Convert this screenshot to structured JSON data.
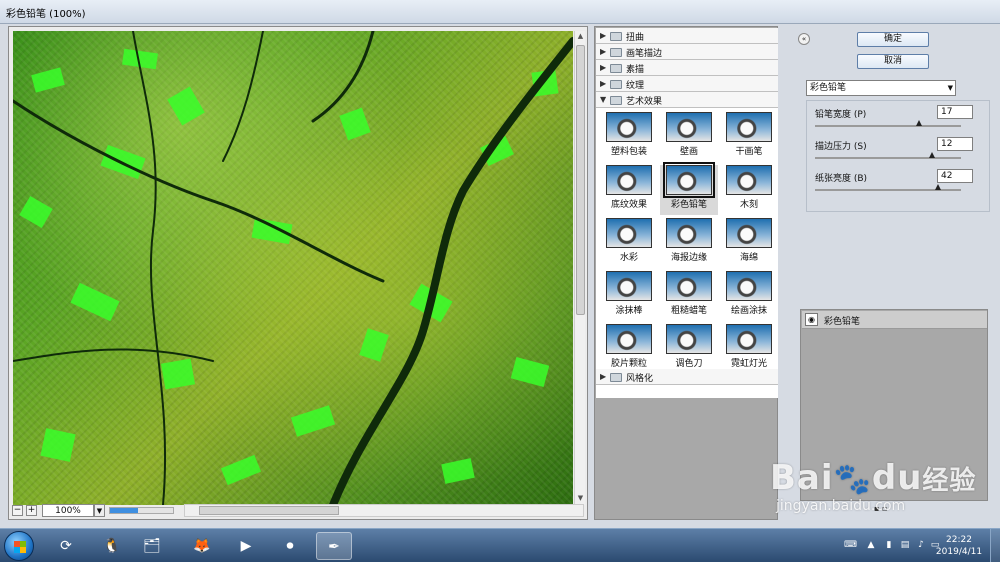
{
  "window": {
    "title": "彩色铅笔 (100%)"
  },
  "preview": {
    "zoom": "100%",
    "progress": 0.45
  },
  "filter_groups_top": [
    {
      "label": "扭曲",
      "expanded": false
    },
    {
      "label": "画笔描边",
      "expanded": false
    },
    {
      "label": "素描",
      "expanded": false
    },
    {
      "label": "纹理",
      "expanded": false
    },
    {
      "label": "艺术效果",
      "expanded": true
    }
  ],
  "filter_groups_bottom": [
    {
      "label": "风格化",
      "expanded": false
    }
  ],
  "artistic_filters": [
    "塑料包装",
    "壁画",
    "干画笔",
    "底纹效果",
    "彩色铅笔",
    "木刻",
    "水彩",
    "海报边缘",
    "海绵",
    "涂抹棒",
    "粗糙蜡笔",
    "绘画涂抹",
    "胶片颗粒",
    "调色刀",
    "霓虹灯光"
  ],
  "selected_filter": "彩色铅笔",
  "buttons": {
    "ok": "确定",
    "cancel": "取消"
  },
  "settings": {
    "filter_select": "彩色铅笔",
    "params": [
      {
        "label": "铅笔宽度 (P)",
        "value": "17",
        "level": 0.71
      },
      {
        "label": "描边压力 (S)",
        "value": "12",
        "level": 0.8
      },
      {
        "label": "纸张亮度 (B)",
        "value": "42",
        "level": 0.84
      }
    ]
  },
  "layers": [
    {
      "name": "彩色铅笔",
      "visible": true
    }
  ],
  "taskbar": {
    "apps": [
      "360-icon",
      "qq-icon",
      "explorer-icon",
      "firefox-icon",
      "media-icon",
      "record-icon",
      "photoshop-icon"
    ],
    "time": "22:22",
    "date": "2019/4/11"
  },
  "watermark": {
    "logo": "Baidu经验",
    "url": "jingyan.baidu.com"
  }
}
